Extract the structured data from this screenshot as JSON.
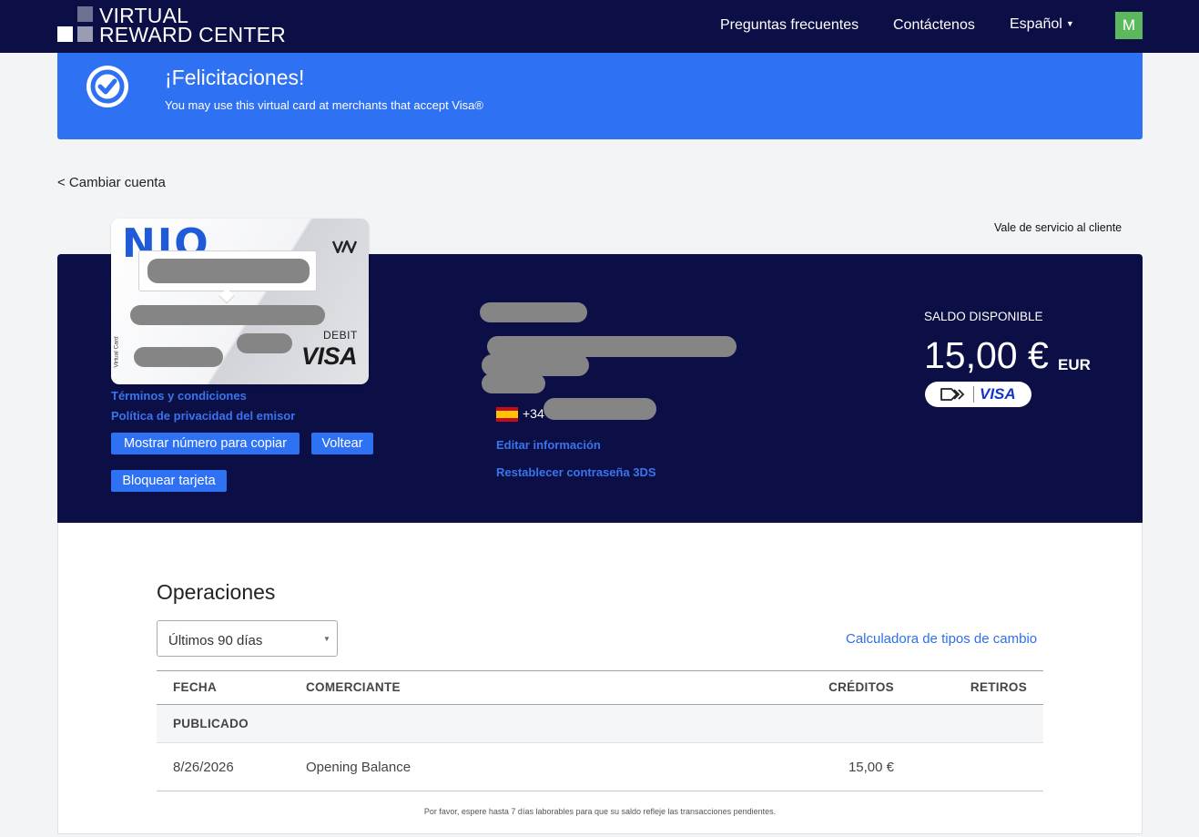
{
  "nav": {
    "logo_line1": "VIRTUAL",
    "logo_line2": "REWARD CENTER",
    "faq": "Preguntas frecuentes",
    "contact": "Contáctenos",
    "language": "Español",
    "avatar_initial": "M"
  },
  "banner": {
    "title": "¡Felicitaciones!",
    "message": "You may use this virtual card at merchants that accept Visa®",
    "icon": "check-circle-icon"
  },
  "back_link": "< Cambiar cuenta",
  "voucher_link": "Vale de servicio al cliente",
  "card": {
    "brand": "NIO",
    "type_label": "DEBIT",
    "network": "VISA",
    "side_label": "Virtual Card",
    "terms_link": "Términos y condiciones",
    "privacy_link": "Política de privacidad del emisor",
    "show_number_button": "Mostrar número para copiar",
    "flip_button": "Voltear",
    "block_button": "Bloquear tarjeta"
  },
  "account": {
    "phone_prefix": "+34",
    "edit_link": "Editar información",
    "reset_3ds_link": "Restablecer contraseña 3DS"
  },
  "balance": {
    "label": "SALDO DISPONIBLE",
    "amount": "15,00 €",
    "currency": "EUR",
    "badge_network": "VISA"
  },
  "operations": {
    "title": "Operaciones",
    "range_selected": "Últimos 90 días",
    "fx_link": "Calculadora de tipos de cambio",
    "columns": {
      "date": "FECHA",
      "merchant": "COMERCIANTE",
      "credits": "CRÉDITOS",
      "debits": "RETIROS"
    },
    "group_label": "PUBLICADO",
    "rows": [
      {
        "date": "8/26/2026",
        "merchant": "Opening Balance",
        "credit": "15,00 €",
        "debit": ""
      }
    ],
    "note": "Por favor, espere hasta 7 días laborables para que su saldo refleje las transacciones pendientes."
  },
  "colors": {
    "navy": "#0c0f45",
    "accent_blue": "#2e71f3",
    "link_blue": "#3a74ec",
    "avatar_green": "#5cb85c",
    "redaction_gray": "#858585"
  }
}
